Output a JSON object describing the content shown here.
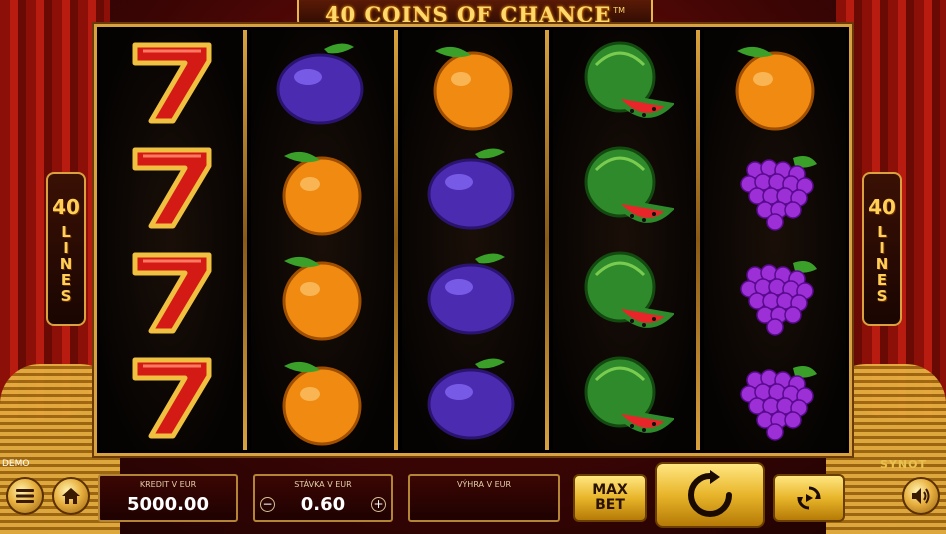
{
  "game": {
    "title": "40 COINS OF CHANCE",
    "trademark": "TM",
    "lines_number": "40",
    "lines_word": "LINES",
    "demo_label": "DEMO",
    "brand": "SYNOT"
  },
  "reels": [
    [
      "seven",
      "seven",
      "seven",
      "seven"
    ],
    [
      "plum",
      "orange",
      "orange",
      "orange"
    ],
    [
      "orange",
      "plum",
      "plum",
      "plum"
    ],
    [
      "watermelon",
      "watermelon",
      "watermelon",
      "watermelon"
    ],
    [
      "orange",
      "grapes",
      "grapes",
      "grapes"
    ]
  ],
  "controls": {
    "credit": {
      "label": "KREDIT V EUR",
      "value": "5000.00"
    },
    "bet": {
      "label": "STÁVKA V EUR",
      "value": "0.60",
      "minus": "−",
      "plus": "+"
    },
    "win": {
      "label": "VÝHRA V EUR",
      "value": ""
    },
    "max_bet": {
      "line1": "MAX",
      "line2": "BET"
    }
  },
  "icons": {
    "menu": "menu-icon",
    "home": "home-icon",
    "spin": "spin-icon",
    "autoplay": "autoplay-icon",
    "sound": "speaker-icon"
  },
  "colors": {
    "gold": "#d9a23e",
    "panel": "#3b0603",
    "curtain": "#b81c10"
  }
}
